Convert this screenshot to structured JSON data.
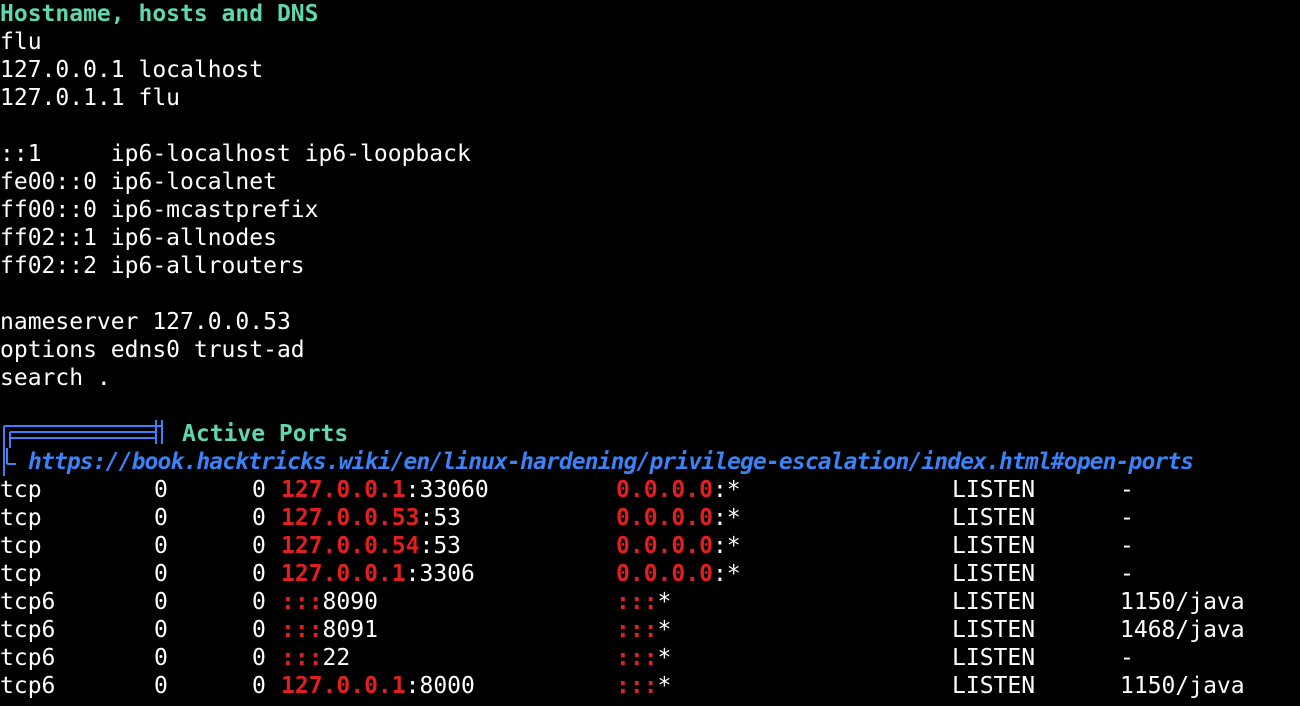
{
  "hosts_section": {
    "heading": "Hostname, hosts and DNS",
    "lines": [
      "flu",
      "127.0.0.1 localhost",
      "127.0.1.1 flu",
      "",
      "::1     ip6-localhost ip6-loopback",
      "fe00::0 ip6-localnet",
      "ff00::0 ip6-mcastprefix",
      "ff02::1 ip6-allnodes",
      "ff02::2 ip6-allrouters",
      "",
      "nameserver 127.0.0.53",
      "options edns0 trust-ad",
      "search ."
    ]
  },
  "ports_section": {
    "title": "Active Ports",
    "link": "https://book.hacktricks.wiki/en/linux-hardening/privilege-escalation/index.html#open-ports",
    "rows": [
      {
        "proto": "tcp",
        "recv": "0",
        "send": "0",
        "local_ip": "127.0.0.1",
        "local_port": ":33060",
        "foreign_ip": "0.0.0.0",
        "foreign_port": ":*",
        "state": "LISTEN",
        "pid": "-"
      },
      {
        "proto": "tcp",
        "recv": "0",
        "send": "0",
        "local_ip": "127.0.0.53",
        "local_port": ":53",
        "foreign_ip": "0.0.0.0",
        "foreign_port": ":*",
        "state": "LISTEN",
        "pid": "-"
      },
      {
        "proto": "tcp",
        "recv": "0",
        "send": "0",
        "local_ip": "127.0.0.54",
        "local_port": ":53",
        "foreign_ip": "0.0.0.0",
        "foreign_port": ":*",
        "state": "LISTEN",
        "pid": "-"
      },
      {
        "proto": "tcp",
        "recv": "0",
        "send": "0",
        "local_ip": "127.0.0.1",
        "local_port": ":3306",
        "foreign_ip": "0.0.0.0",
        "foreign_port": ":*",
        "state": "LISTEN",
        "pid": "-"
      },
      {
        "proto": "tcp6",
        "recv": "0",
        "send": "0",
        "local_ip": ":::",
        "local_port": "8090",
        "foreign_ip": ":::",
        "foreign_port": "*",
        "state": "LISTEN",
        "pid": "1150/java"
      },
      {
        "proto": "tcp6",
        "recv": "0",
        "send": "0",
        "local_ip": ":::",
        "local_port": "8091",
        "foreign_ip": ":::",
        "foreign_port": "*",
        "state": "LISTEN",
        "pid": "1468/java"
      },
      {
        "proto": "tcp6",
        "recv": "0",
        "send": "0",
        "local_ip": ":::",
        "local_port": "22",
        "foreign_ip": ":::",
        "foreign_port": "*",
        "state": "LISTEN",
        "pid": "-"
      },
      {
        "proto": "tcp6",
        "recv": "0",
        "send": "0",
        "local_ip": "127.0.0.1",
        "local_port": ":8000",
        "foreign_ip": ":::",
        "foreign_port": "*",
        "state": "LISTEN",
        "pid": "1150/java"
      }
    ]
  },
  "colors": {
    "background": "#000000",
    "text": "#ffffff",
    "heading": "#5fd7af",
    "link": "#3b82f6",
    "highlight_ip": "#e02020",
    "box_art": "#3b82f6"
  }
}
